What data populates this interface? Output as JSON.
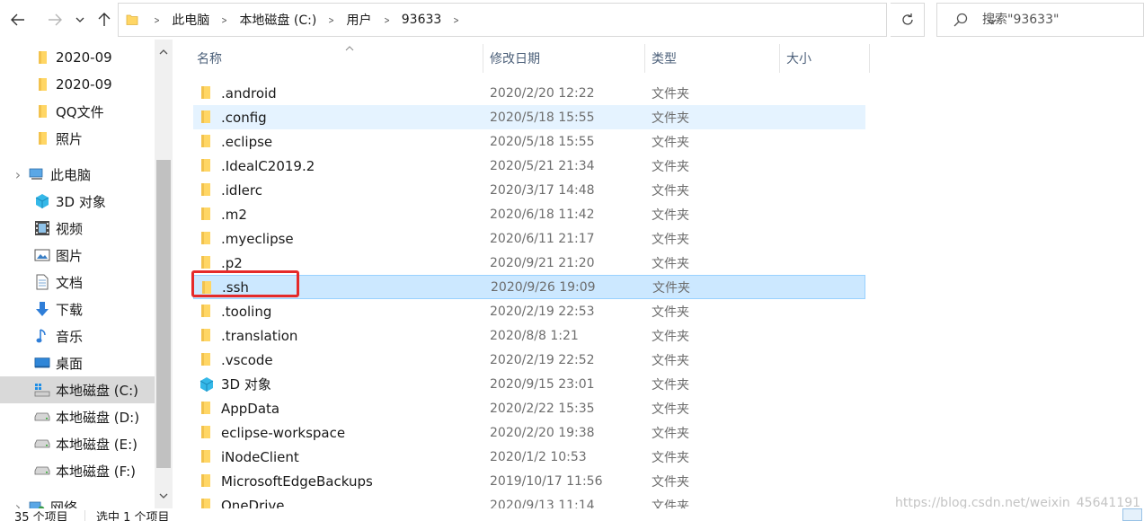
{
  "address_bar": {
    "breadcrumbs": [
      "此电脑",
      "本地磁盘 (C:)",
      "用户",
      "93633"
    ]
  },
  "search": {
    "placeholder": "搜索\"93633\""
  },
  "sidebar": {
    "items": [
      {
        "label": "2020-09",
        "icon": "folder-icon",
        "expander": false
      },
      {
        "label": "2020-09",
        "icon": "folder-icon",
        "expander": false
      },
      {
        "label": "QQ文件",
        "icon": "folder-icon",
        "expander": false
      },
      {
        "label": "照片",
        "icon": "folder-icon",
        "expander": false
      },
      {
        "label": "此电脑",
        "icon": "this-pc-icon",
        "expander": true
      },
      {
        "label": "3D 对象",
        "icon": "3d-objects-icon",
        "expander": false
      },
      {
        "label": "视频",
        "icon": "videos-icon",
        "expander": false
      },
      {
        "label": "图片",
        "icon": "pictures-icon",
        "expander": false
      },
      {
        "label": "文档",
        "icon": "documents-icon",
        "expander": false
      },
      {
        "label": "下载",
        "icon": "downloads-icon",
        "expander": false
      },
      {
        "label": "音乐",
        "icon": "music-icon",
        "expander": false
      },
      {
        "label": "桌面",
        "icon": "desktop-icon",
        "expander": false
      },
      {
        "label": "本地磁盘 (C:)",
        "icon": "system-drive-icon",
        "expander": false,
        "selected": true
      },
      {
        "label": "本地磁盘 (D:)",
        "icon": "drive-icon",
        "expander": false
      },
      {
        "label": "本地磁盘 (E:)",
        "icon": "drive-icon",
        "expander": false
      },
      {
        "label": "本地磁盘 (F:)",
        "icon": "drive-icon",
        "expander": false
      },
      {
        "label": "网络",
        "icon": "network-icon",
        "expander": true
      }
    ]
  },
  "columns": {
    "name": "名称",
    "date": "修改日期",
    "type": "类型",
    "size": "大小"
  },
  "files": [
    {
      "name": ".android",
      "date": "2020/2/20 12:22",
      "type": "文件夹",
      "icon": "folder-icon"
    },
    {
      "name": ".config",
      "date": "2020/5/18 15:55",
      "type": "文件夹",
      "icon": "folder-icon",
      "state": "hover"
    },
    {
      "name": ".eclipse",
      "date": "2020/5/18 15:55",
      "type": "文件夹",
      "icon": "folder-icon"
    },
    {
      "name": ".IdealC2019.2",
      "date": "2020/5/21 21:34",
      "type": "文件夹",
      "icon": "folder-icon"
    },
    {
      "name": ".idlerc",
      "date": "2020/3/17 14:48",
      "type": "文件夹",
      "icon": "folder-icon"
    },
    {
      "name": ".m2",
      "date": "2020/6/18 11:42",
      "type": "文件夹",
      "icon": "folder-icon"
    },
    {
      "name": ".myeclipse",
      "date": "2020/6/11 21:17",
      "type": "文件夹",
      "icon": "folder-icon"
    },
    {
      "name": ".p2",
      "date": "2020/9/21 21:20",
      "type": "文件夹",
      "icon": "folder-icon"
    },
    {
      "name": ".ssh",
      "date": "2020/9/26 19:09",
      "type": "文件夹",
      "icon": "folder-icon",
      "state": "selected"
    },
    {
      "name": ".tooling",
      "date": "2020/2/19 22:53",
      "type": "文件夹",
      "icon": "folder-icon"
    },
    {
      "name": ".translation",
      "date": "2020/8/8 1:21",
      "type": "文件夹",
      "icon": "folder-icon"
    },
    {
      "name": ".vscode",
      "date": "2020/2/19 22:52",
      "type": "文件夹",
      "icon": "folder-icon"
    },
    {
      "name": "3D 对象",
      "date": "2020/9/15 23:01",
      "type": "文件夹",
      "icon": "3d-objects-icon"
    },
    {
      "name": "AppData",
      "date": "2020/2/22 15:35",
      "type": "文件夹",
      "icon": "folder-icon"
    },
    {
      "name": "eclipse-workspace",
      "date": "2020/2/20 19:38",
      "type": "文件夹",
      "icon": "folder-icon"
    },
    {
      "name": "iNodeClient",
      "date": "2020/1/2 10:53",
      "type": "文件夹",
      "icon": "folder-icon"
    },
    {
      "name": "MicrosoftEdgeBackups",
      "date": "2019/10/17 11:56",
      "type": "文件夹",
      "icon": "folder-icon"
    },
    {
      "name": "OneDrive",
      "date": "2020/9/13 11:14",
      "type": "文件夹",
      "icon": "onedrive-folder-icon"
    }
  ],
  "status": {
    "item_count": "35 个项目",
    "selected_count": "选中 1 个项目"
  },
  "watermark": "https://blog.csdn.net/weixin_45641191",
  "colors": {
    "hover_row": "#e5f3ff",
    "selected_row": "#cce8ff",
    "highlight_box": "#e52a2a",
    "folder_yellow": "#ffd665"
  }
}
